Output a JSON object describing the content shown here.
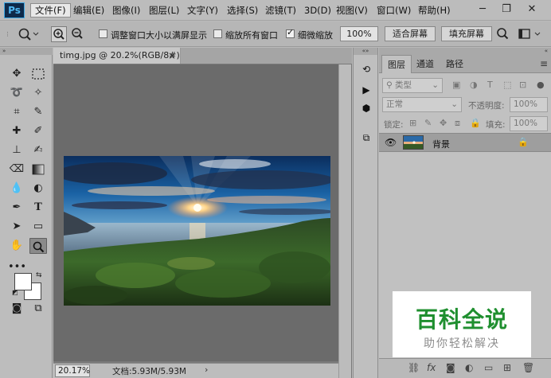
{
  "app": {
    "logo": "Ps"
  },
  "menu": [
    "文件(F)",
    "编辑(E)",
    "图像(I)",
    "图层(L)",
    "文字(Y)",
    "选择(S)",
    "滤镜(T)",
    "3D(D)",
    "视图(V)",
    "窗口(W)",
    "帮助(H)"
  ],
  "options": {
    "resize_windows": "调整窗口大小以满屏显示",
    "zoom_all": "缩放所有窗口",
    "scrubby_zoom": "细微缩放",
    "zoom_value": "100%",
    "fit_screen": "适合屏幕",
    "fill_screen": "填充屏幕"
  },
  "document": {
    "tab_title": "timg.jpg @ 20.2%(RGB/8#)",
    "close_glyph": "×",
    "zoom": "20.17%",
    "info": "文档:5.93M/5.93M"
  },
  "layers": {
    "tabs": [
      "图层",
      "通道",
      "路径"
    ],
    "filter_kind": "类型",
    "blend_mode": "正常",
    "opacity_label": "不透明度:",
    "opacity_value": "100%",
    "lock_label": "锁定:",
    "fill_label": "填充:",
    "fill_value": "100%",
    "layer_name": "背景"
  },
  "watermark": {
    "title": "百科全说",
    "subtitle": "助你轻松解决"
  }
}
